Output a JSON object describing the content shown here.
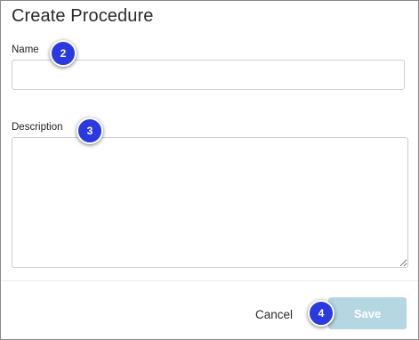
{
  "dialog": {
    "title": "Create Procedure",
    "name_label": "Name",
    "name_value": "",
    "description_label": "Description",
    "description_value": "",
    "cancel_label": "Cancel",
    "save_label": "Save"
  },
  "colors": {
    "step_badge": "#2b3ae0",
    "save_disabled": "#b4d7e1"
  },
  "step_markers": [
    "2",
    "3",
    "4"
  ]
}
